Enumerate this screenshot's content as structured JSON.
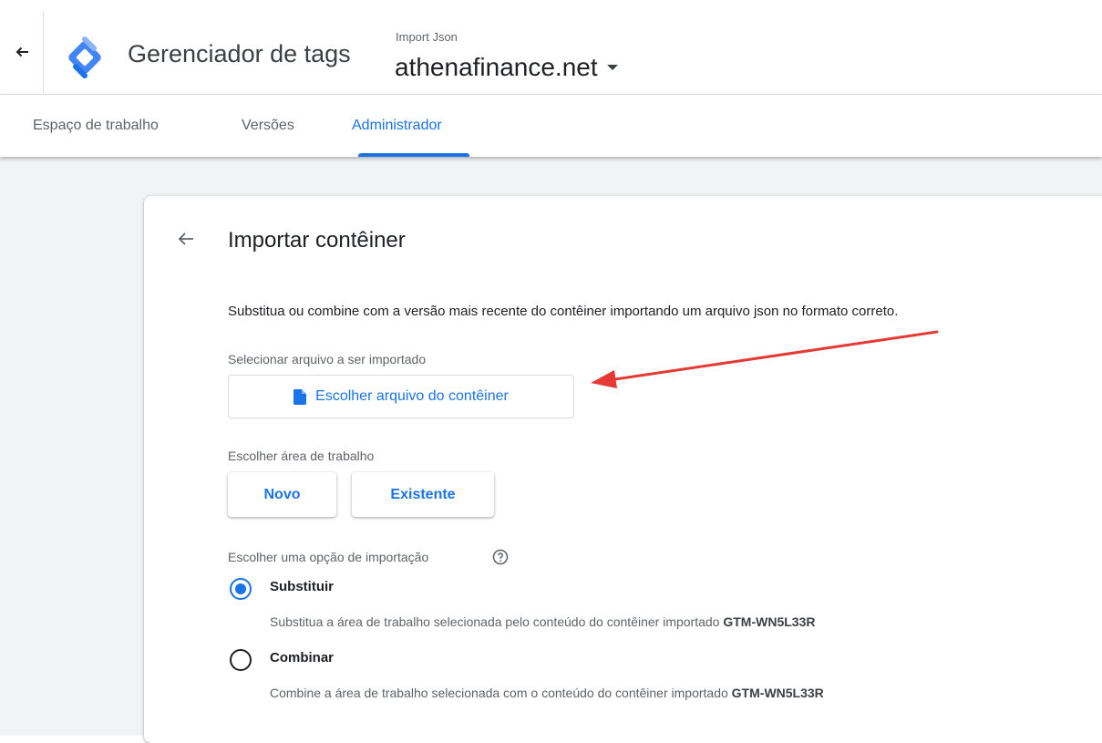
{
  "header": {
    "product_name": "Gerenciador de tags",
    "account_name": "Import Json",
    "container_name": "athenafinance.net"
  },
  "tabs": [
    {
      "label": "Espaço de trabalho"
    },
    {
      "label": "Versões"
    },
    {
      "label": "Administrador",
      "active": true
    }
  ],
  "page": {
    "title": "Importar contêiner",
    "description": "Substitua ou combine com a versão mais recente do contêiner importando um arquivo json no formato correto.",
    "file_section_label": "Selecionar arquivo a ser importado",
    "file_button_label": "Escolher arquivo do contêiner",
    "workspace_section_label": "Escolher área de trabalho",
    "workspace_buttons": [
      "Novo",
      "Existente"
    ],
    "import_option_label": "Escolher uma opção de importação",
    "options": [
      {
        "label": "Substituir",
        "selected": true,
        "description": "Substitua a área de trabalho selecionada pelo conteúdo do contêiner importado",
        "container_id": "GTM-WN5L33R"
      },
      {
        "label": "Combinar",
        "selected": false,
        "description": "Combine a área de trabalho selecionada com o conteúdo do contêiner importado",
        "container_id": "GTM-WN5L33R"
      }
    ]
  },
  "icons": {
    "back": "arrow-left-icon",
    "logo": "gtm-logo",
    "dropdown": "caret-down-icon",
    "file": "file-icon",
    "help": "help-circle-icon"
  },
  "colors": {
    "accent": "#1a73e8",
    "annotation_arrow": "#e53935",
    "background": "#f1f3f4"
  }
}
